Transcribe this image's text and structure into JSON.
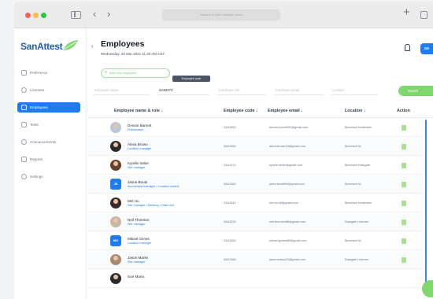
{
  "titlebar": {
    "url": "Search or enter website name"
  },
  "sidebar": {
    "logo": "SanAttest",
    "items": [
      {
        "label": "Preference",
        "icon": "preference-icon"
      },
      {
        "label": "Licenses",
        "icon": "license-icon"
      },
      {
        "label": "Employees",
        "icon": "employees-icon",
        "active": true
      },
      {
        "label": "Tests",
        "icon": "tests-icon"
      },
      {
        "label": "Announcements",
        "icon": "announcements-icon"
      },
      {
        "label": "Reports",
        "icon": "reports-icon"
      },
      {
        "label": "Settings",
        "icon": "settings-icon"
      }
    ]
  },
  "header": {
    "title": "Employees",
    "date": "Wednesday, 23 Mar 2021 11:20 AM CET",
    "avatar": "GE"
  },
  "toolbar": {
    "add_label": "Add new employee",
    "search_label": "Search"
  },
  "filters": {
    "name_placeholder": "Employee name",
    "code_value": "SA02274",
    "code_tooltip": "Employee code",
    "role_placeholder": "Employee role",
    "email_placeholder": "Employee email",
    "location_placeholder": "Location"
  },
  "table": {
    "headers": {
      "name": "Employee name & role ↓",
      "code": "Employee code ↓",
      "email": "Employee email ↓",
      "location": "Location ↓",
      "action": "Action"
    },
    "rows": [
      {
        "name": "Dennis Barnett",
        "role": "Policymaker",
        "code": "SA01553",
        "email": "dennis.barnett22@gmail.com",
        "location": "Beneluxe Northstein",
        "avatar_color": "#b9c7d8"
      },
      {
        "name": "Alexa Brown",
        "role": "Location manager",
        "code": "SA01554",
        "email": "alexa.brown19@gmail.com",
        "location": "Beneluxe IA",
        "avatar_color": "#2b2b2b"
      },
      {
        "name": "Kyrelle Selier",
        "role": "Site manager",
        "code": "SA01574",
        "email": "kyrelle.selier@gmail.com",
        "location": "Beneluxe Eastgate",
        "avatar_color": "#6b3f2a"
      },
      {
        "name": "Jaime Boule",
        "role": "Accountant manager • Location control",
        "code": "SA01562",
        "email": "jaime.boule88@gmail.com",
        "location": "Beneluxe IA",
        "avatar_color": "#1d7cf2",
        "initials": "JB"
      },
      {
        "name": "Mel Hu",
        "role": "Site manager • Meeting • Gate lock",
        "code": "SA01542",
        "email": "mel.hu18@gmail.com",
        "location": "Beneluxe Northstein",
        "avatar_color": "#3a2a2a"
      },
      {
        "name": "Neil Thornton",
        "role": "Site manager",
        "code": "SA01532",
        "email": "neil.thornton88@gmail.com",
        "location": "Eastgate Lorinner",
        "avatar_color": "#c9b6a5"
      },
      {
        "name": "Mikael Gimes",
        "role": "Location manager",
        "code": "SA01552",
        "email": "mikael.gimes88@gmail.com",
        "location": "Beneluxe IA",
        "avatar_color": "#1d7cf2",
        "initials": "MG"
      },
      {
        "name": "Jason Marks",
        "role": "Site manager",
        "code": "SA01566",
        "email": "jason.marks22@gmail.com",
        "location": "Eastgate Lorinner",
        "avatar_color": "#a98a72"
      },
      {
        "name": "Sue Maria",
        "role": "",
        "code": "",
        "email": "",
        "location": "",
        "avatar_color": "#2b2b2b"
      }
    ]
  },
  "colors": {
    "accent": "#1d7cf2",
    "success": "#7fd66d"
  }
}
